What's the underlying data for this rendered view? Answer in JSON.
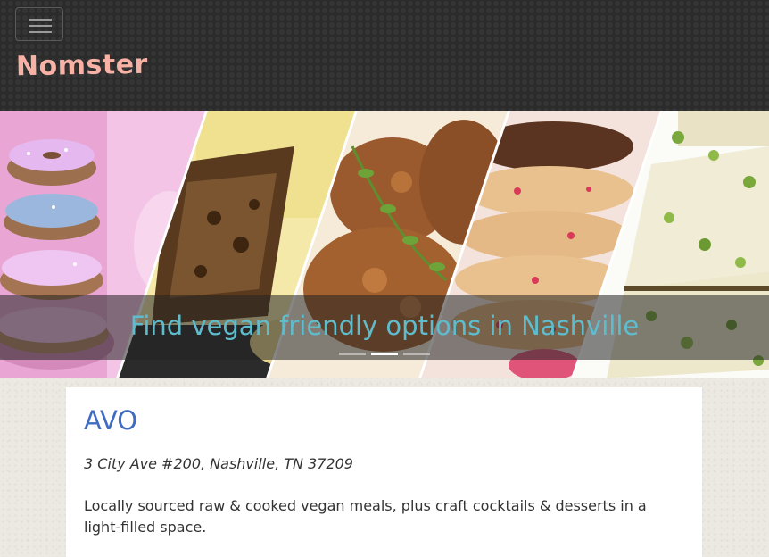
{
  "navbar": {
    "brand": "Nomster",
    "toggler_icon": "hamburger-menu-icon"
  },
  "carousel": {
    "caption": "Find vegan friendly options in Nashville",
    "slides": [
      "donuts",
      "casserole",
      "fried-chicken",
      "cookies",
      "pistachio-bars"
    ],
    "active_index": 1
  },
  "place": {
    "name": "AVO",
    "address": "3 City Ave #200, Nashville, TN 37209",
    "description": "Locally sourced raw & cooked vegan meals, plus craft cocktails & desserts in a light-filled space."
  },
  "colors": {
    "brand": "#f7b2a5",
    "caption": "#5fbccd",
    "title": "#3f6cc2"
  }
}
